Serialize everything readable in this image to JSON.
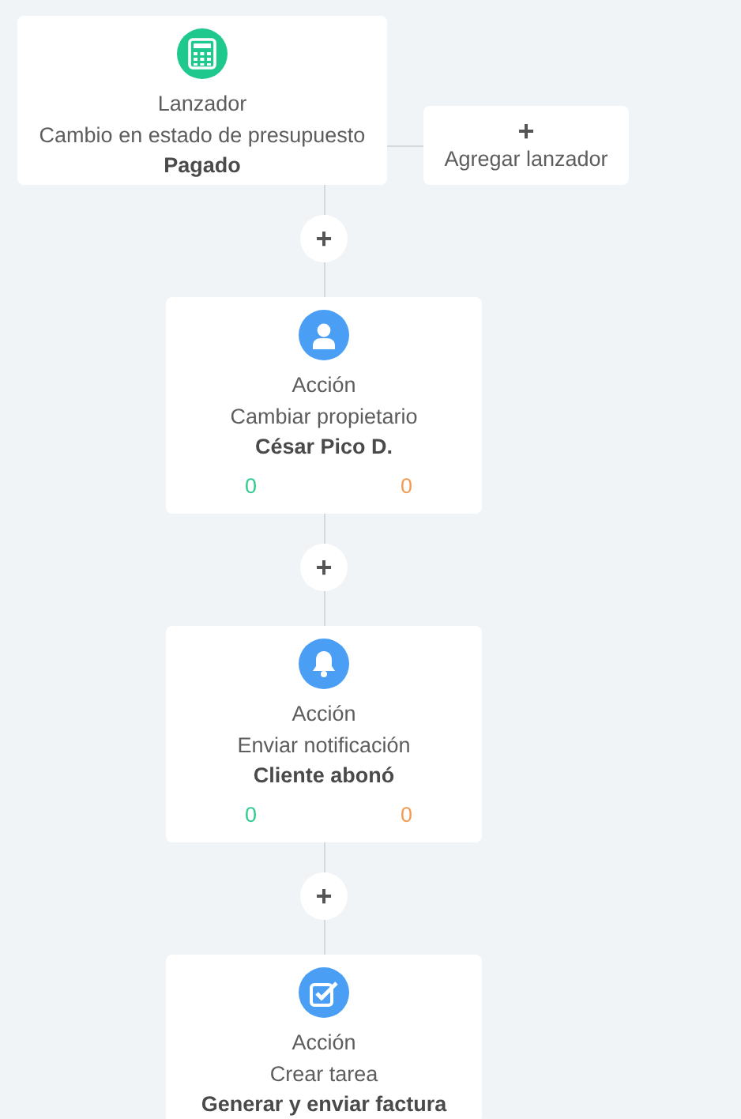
{
  "trigger": {
    "color": "#1fc98e",
    "label": "Lanzador",
    "event": "Cambio en estado de presupuesto",
    "value": "Pagado"
  },
  "add_trigger": {
    "symbol": "+",
    "label": "Agregar lanzador"
  },
  "steps": [
    {
      "kind": "add",
      "symbol": "+"
    },
    {
      "kind": "action",
      "color": "#4a9ff5",
      "label": "Acción",
      "event": "Cambiar propietario",
      "value": "César Pico D.",
      "counts": [
        {
          "text": "0",
          "color": "#2ecc8f"
        },
        {
          "text": "0",
          "color": "#f39a52"
        }
      ]
    },
    {
      "kind": "add",
      "symbol": "+"
    },
    {
      "kind": "action",
      "color": "#4a9ff5",
      "label": "Acción",
      "event": "Enviar notificación",
      "value": "Cliente abonó",
      "counts": [
        {
          "text": "0",
          "color": "#2ecc8f"
        },
        {
          "text": "0",
          "color": "#f39a52"
        }
      ]
    },
    {
      "kind": "add",
      "symbol": "+"
    },
    {
      "kind": "action",
      "color": "#4a9ff5",
      "label": "Acción",
      "event": "Crear tarea",
      "value": "Generar y enviar factura"
    }
  ]
}
